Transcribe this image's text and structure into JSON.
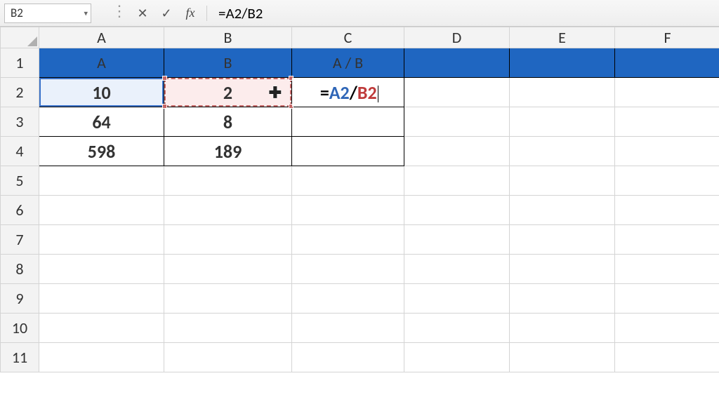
{
  "name_box": {
    "value": "B2"
  },
  "formula_bar": {
    "cancel_tooltip": "Cancel",
    "enter_tooltip": "Enter",
    "fx_label": "fx",
    "value": "=A2/B2"
  },
  "columns": [
    "A",
    "B",
    "C",
    "D",
    "E",
    "F"
  ],
  "rows_visible": 11,
  "header_row": {
    "A": "A",
    "B": "B",
    "C": "A / B"
  },
  "data": {
    "r2": {
      "A": "10",
      "B": "2",
      "C_formula": {
        "eq": "=",
        "a": "A2",
        "op": "/",
        "b": "B2"
      }
    },
    "r3": {
      "A": "64",
      "B": "8",
      "C": ""
    },
    "r4": {
      "A": "598",
      "B": "189",
      "C": ""
    }
  },
  "icons": {
    "dropdown": "▾",
    "cancel": "✕",
    "enter": "✓",
    "divider_dots": "⋮",
    "plus_cursor": "✚"
  },
  "colors": {
    "header_fill": "#1f66c1",
    "ref_a": "#2f66b7",
    "ref_b": "#bf3a3a",
    "active_border": "#1d7044"
  }
}
